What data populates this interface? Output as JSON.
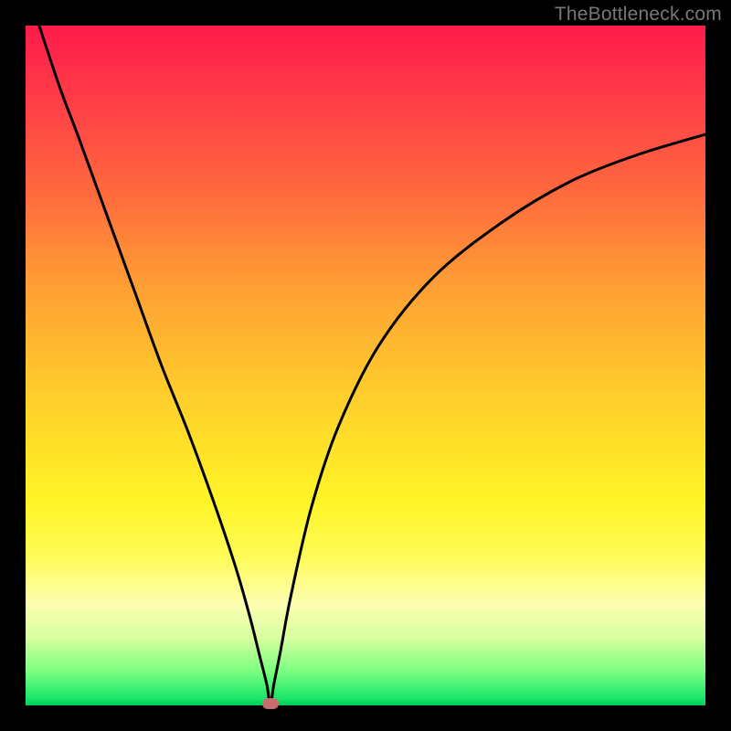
{
  "watermark": "TheBottleneck.com",
  "colors": {
    "background": "#000000",
    "gradient_top": "#ff1b4a",
    "gradient_bottom": "#00cc55",
    "curve_stroke": "#000000",
    "marker_fill": "#c76d6d",
    "watermark_text": "#777777"
  },
  "chart_data": {
    "type": "line",
    "title": "",
    "xlabel": "",
    "ylabel": "",
    "xlim": [
      0,
      100
    ],
    "ylim": [
      0,
      100
    ],
    "grid": false,
    "legend": false,
    "marker": {
      "x": 36,
      "y": 0
    },
    "series": [
      {
        "name": "bottleneck-curve",
        "x": [
          2,
          5,
          8,
          12,
          16,
          20,
          24,
          28,
          31,
          33,
          34.5,
          35.5,
          36,
          36.5,
          37.5,
          39,
          42,
          46,
          52,
          60,
          70,
          80,
          90,
          100
        ],
        "y": [
          100,
          91,
          83,
          72,
          61,
          50,
          40,
          29,
          20,
          13,
          7,
          3,
          0,
          3,
          8,
          16,
          29,
          41,
          53,
          63,
          71,
          77,
          81,
          84
        ]
      }
    ]
  }
}
